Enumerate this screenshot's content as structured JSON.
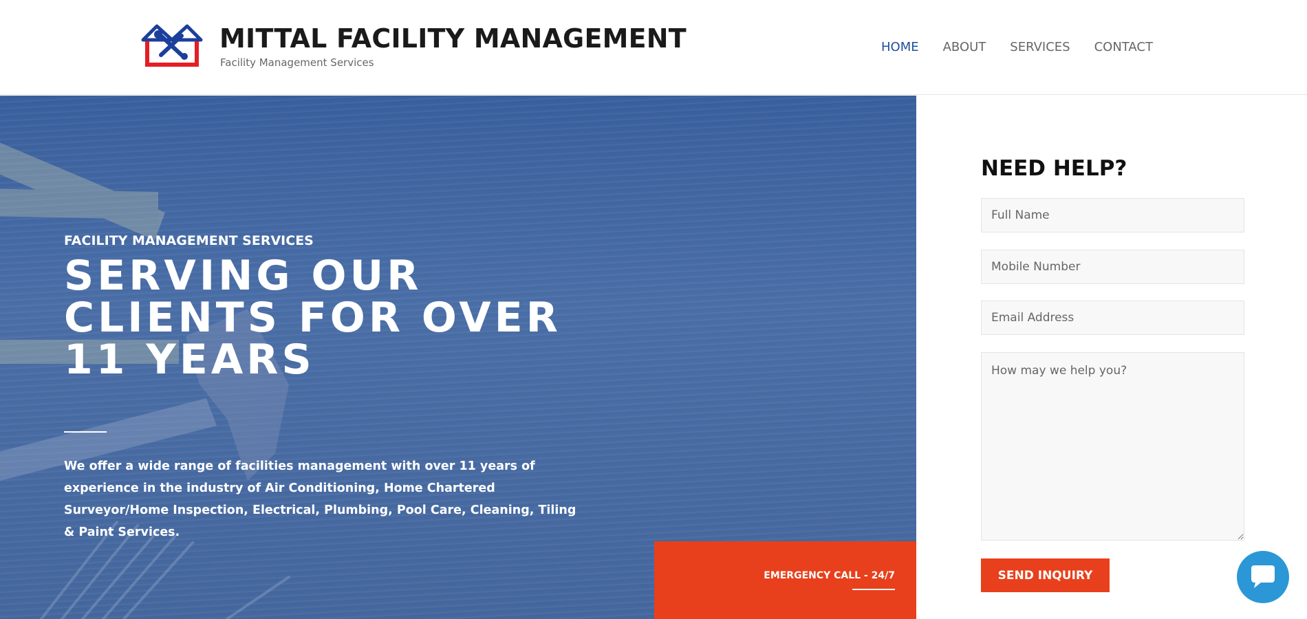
{
  "header": {
    "brand_title": "MITTAL FACILITY MANAGEMENT",
    "brand_subtitle": "Facility Management Services",
    "nav": [
      {
        "label": "HOME",
        "active": true
      },
      {
        "label": "ABOUT",
        "active": false
      },
      {
        "label": "SERVICES",
        "active": false
      },
      {
        "label": "CONTACT",
        "active": false
      }
    ]
  },
  "hero": {
    "kicker": "FACILITY MANAGEMENT SERVICES",
    "title_lines": [
      "SERVING OUR",
      "CLIENTS FOR OVER",
      "11 YEARS"
    ],
    "description": "We offer a wide range of facilities management with over 11 years of experience in the industry of Air Conditioning, Home Chartered Surveyor/Home Inspection, Electrical, Plumbing, Pool Care, Cleaning, Tiling & Paint Services.",
    "emergency_label": "EMERGENCY CALL - 24/7"
  },
  "form": {
    "title": "NEED HELP?",
    "full_name_placeholder": "Full Name",
    "mobile_placeholder": "Mobile Number",
    "email_placeholder": "Email Address",
    "message_placeholder": "How may we help you?",
    "submit_label": "SEND INQUIRY"
  },
  "icons": {
    "logo": "house-tools-logo",
    "chat": "chat-bubble-icon"
  },
  "colors": {
    "brand_blue": "#1e4f9c",
    "accent_red": "#e8401c",
    "hero_overlay": "#3f65a3",
    "chat_blue": "#2b97d6"
  }
}
